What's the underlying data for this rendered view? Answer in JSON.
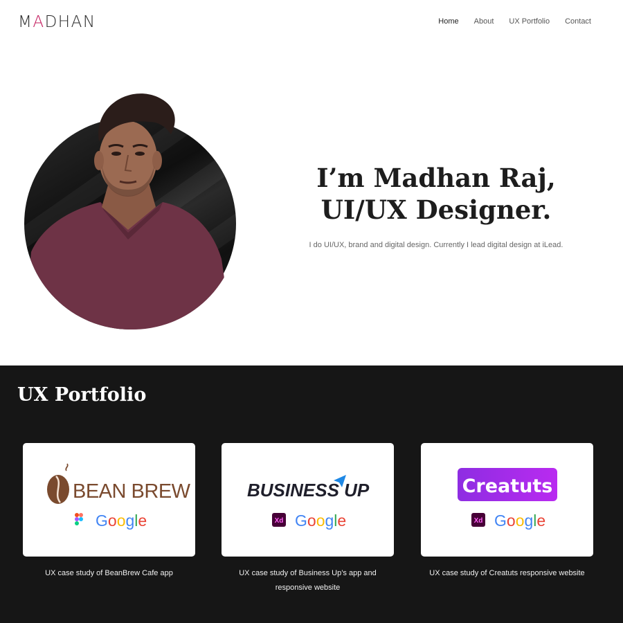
{
  "header": {
    "logo": {
      "pre": "M",
      "accent": "A",
      "post": "DHAN"
    },
    "nav": [
      {
        "label": "Home",
        "active": true
      },
      {
        "label": "About",
        "active": false
      },
      {
        "label": "UX Portfolio",
        "active": false
      },
      {
        "label": "Contact",
        "active": false
      }
    ]
  },
  "hero": {
    "title_line1": "I’m Madhan Raj,",
    "title_line2": "UI/UX Designer.",
    "subtitle": "I do UI/UX, brand and digital design. Currently I lead digital design at iLead."
  },
  "portfolio": {
    "title": "UX Portfolio",
    "cards": [
      {
        "brand": "BEAN BREW",
        "tool_icon": "figma-icon",
        "platform": "Google",
        "caption": "UX case study of BeanBrew Cafe app"
      },
      {
        "brand": "BUSINESS UP",
        "tool_icon": "adobe-xd-icon",
        "tool_label": "Xd",
        "platform": "Google",
        "caption": "UX case study of Business Up’s app and responsive website"
      },
      {
        "brand": "Creatuts",
        "tool_icon": "adobe-xd-icon",
        "tool_label": "Xd",
        "platform": "Google",
        "caption": "UX case study of Creatuts responsive website"
      }
    ]
  },
  "colors": {
    "accent": "#c2185b",
    "dark_section": "#161616",
    "creatuts_purple": "#8e2de2"
  }
}
